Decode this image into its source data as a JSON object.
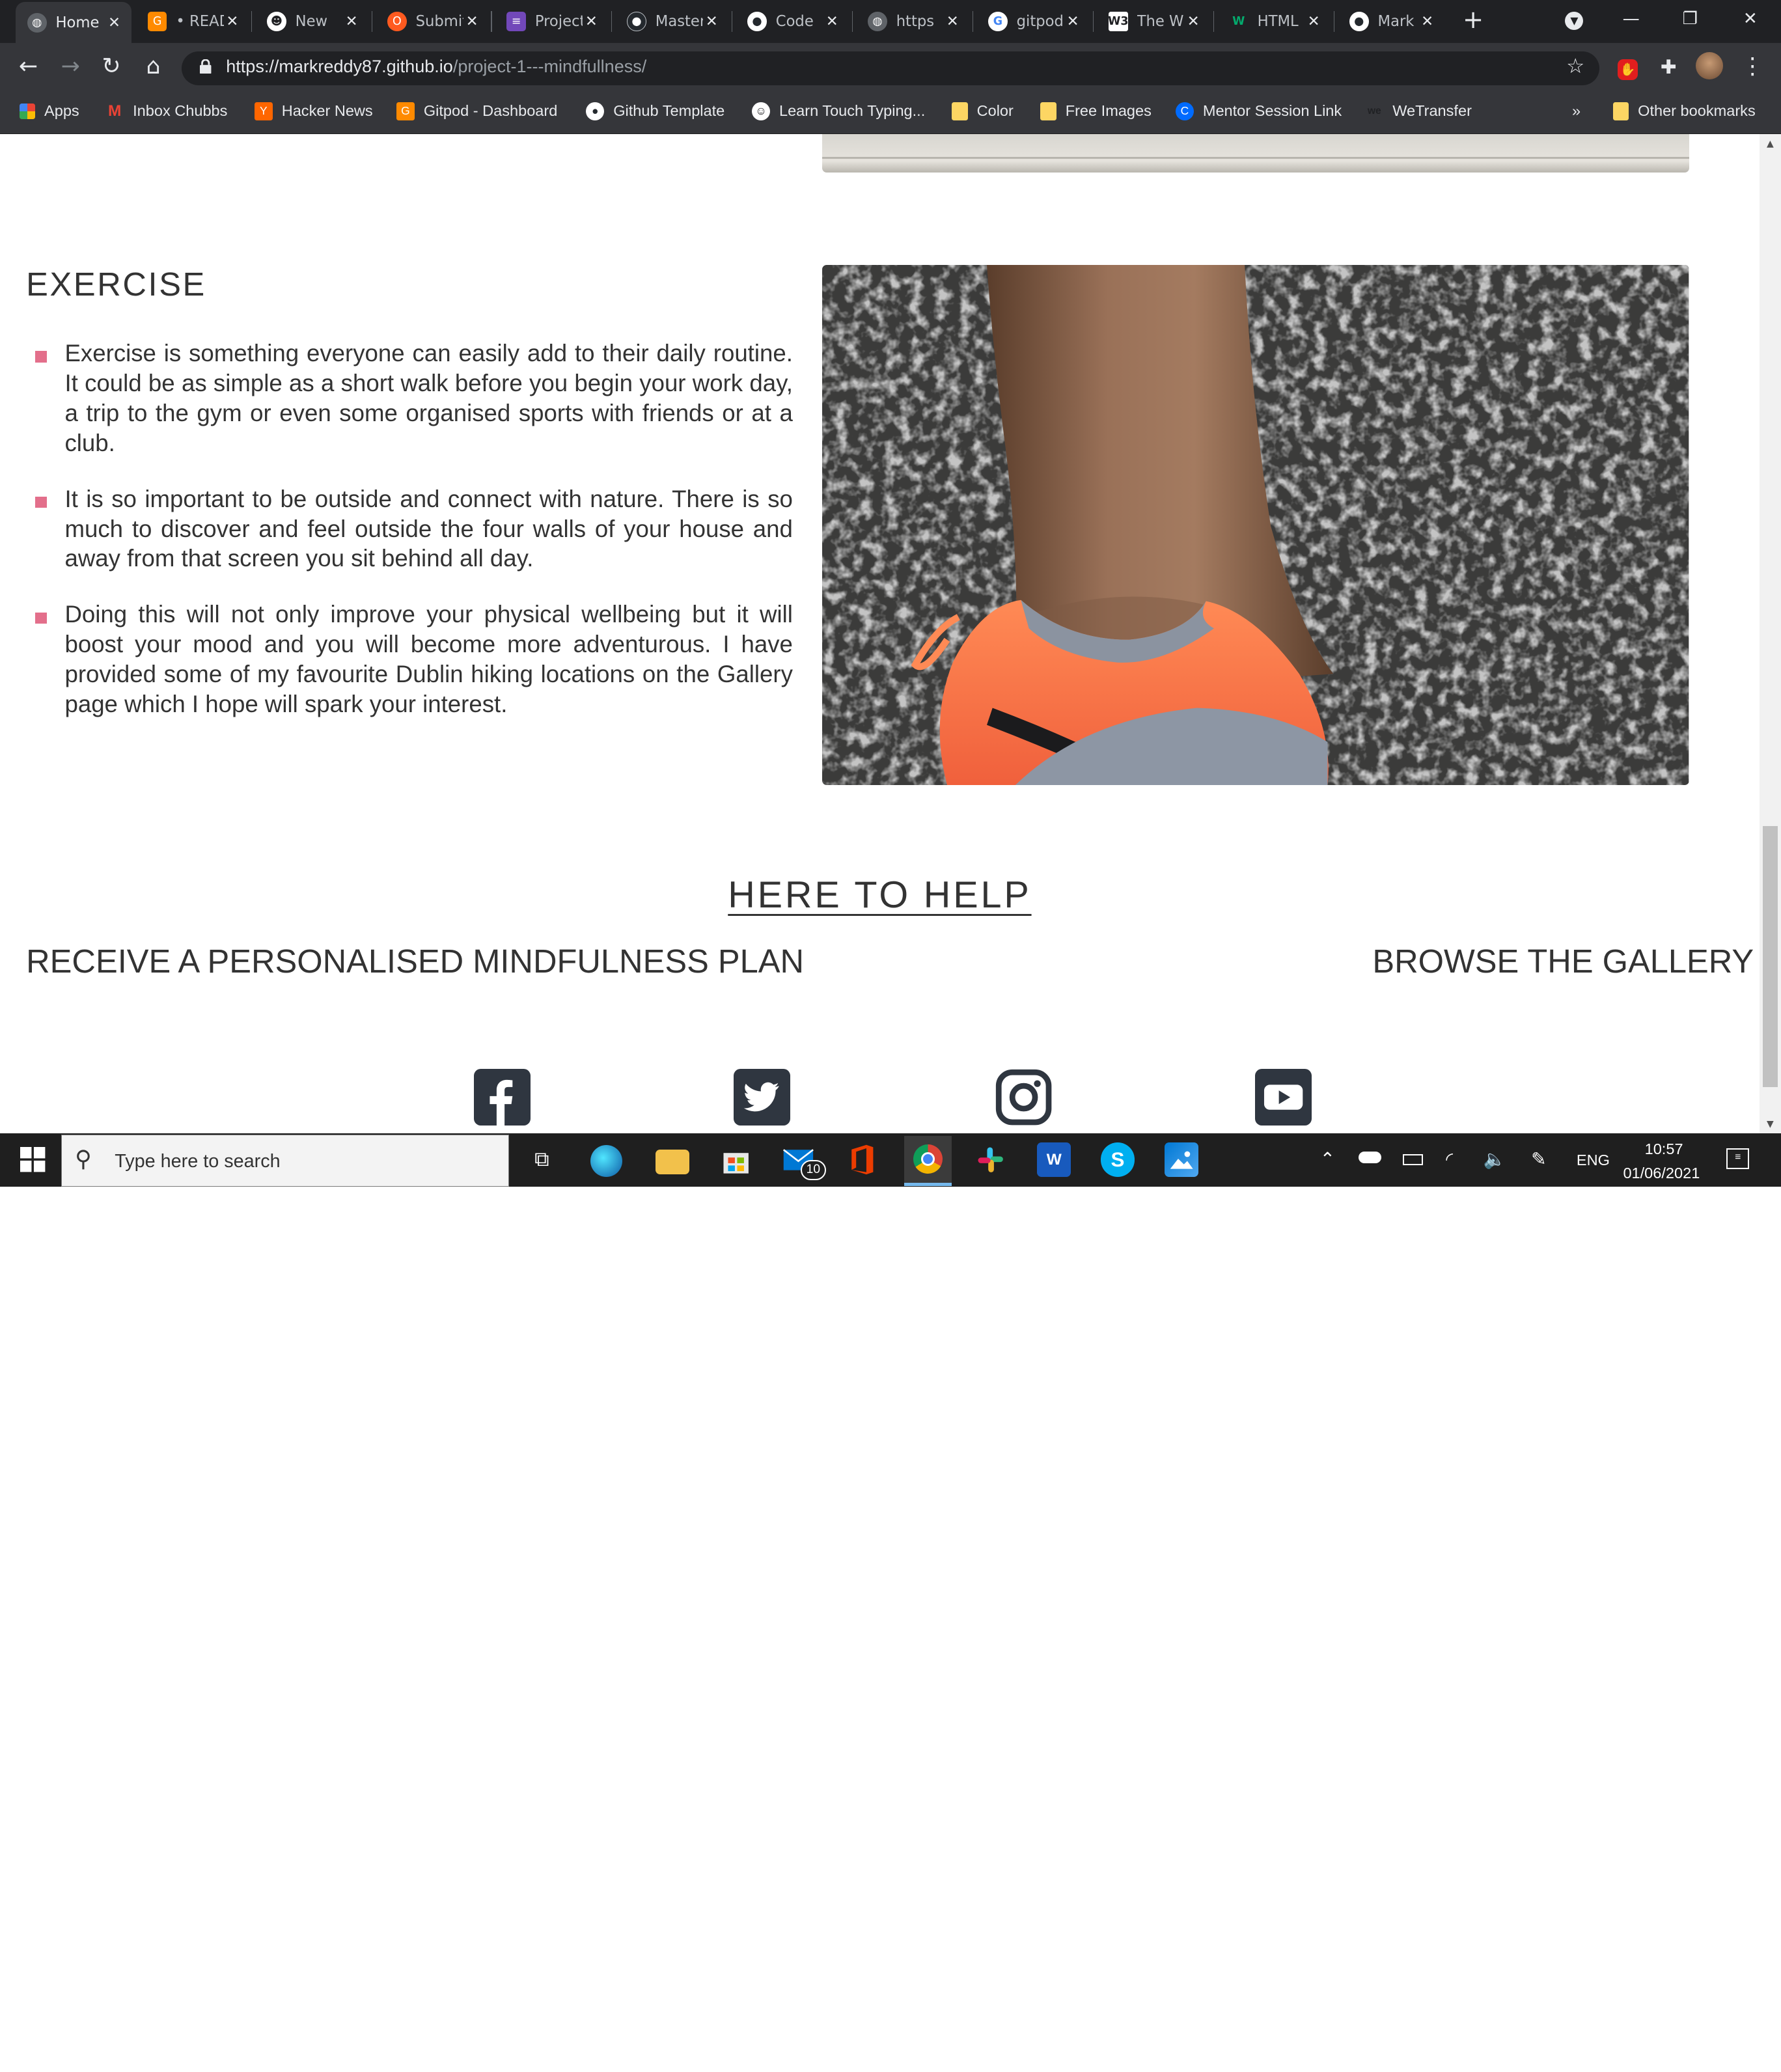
{
  "browser": {
    "tabs": [
      {
        "title": "Home",
        "icon": "globe-icon",
        "active": true
      },
      {
        "title": "• README",
        "icon": "gitpod-icon"
      },
      {
        "title": "New",
        "icon": "smiley-icon"
      },
      {
        "title": "Submit",
        "icon": "opera-icon"
      },
      {
        "title": "Project",
        "icon": "form-icon"
      },
      {
        "title": "Master",
        "icon": "github-icon"
      },
      {
        "title": "Code",
        "icon": "github-icon"
      },
      {
        "title": "https",
        "icon": "globe-icon"
      },
      {
        "title": "gitpod",
        "icon": "google-icon"
      },
      {
        "title": "The W",
        "icon": "w3schools-icon"
      },
      {
        "title": "HTML",
        "icon": "w3-green-icon"
      },
      {
        "title": "Mark",
        "icon": "github-icon"
      }
    ],
    "url_host": "https://markreddy87.github.io",
    "url_path": "/project-1---mindfullness/",
    "bookmarks": [
      {
        "label": "Apps",
        "icon": "apps-grid-icon"
      },
      {
        "label": "Inbox Chubbs",
        "icon": "gmail-icon"
      },
      {
        "label": "Hacker News",
        "icon": "hacker-news-icon"
      },
      {
        "label": "Gitpod - Dashboard",
        "icon": "gitpod-icon"
      },
      {
        "label": "Github Template",
        "icon": "github-icon"
      },
      {
        "label": "Learn Touch Typing...",
        "icon": "typing-icon"
      },
      {
        "label": "Color",
        "icon": "folder-icon"
      },
      {
        "label": "Free Images",
        "icon": "folder-icon"
      },
      {
        "label": "Mentor Session Link",
        "icon": "calendly-icon"
      },
      {
        "label": "WeTransfer",
        "icon": "wetransfer-icon"
      }
    ],
    "bookmarks_overflow": "»",
    "other_bookmarks": "Other bookmarks"
  },
  "page": {
    "exercise_heading": "EXERCISE",
    "exercise_points": [
      "Exercise is something everyone can easily add to their daily routine. It could be as simple as a short walk before you begin your work day, a trip to the gym or even some organised sports with friends or at a club.",
      "It is so important to be outside and connect with nature. There is so much to discover and feel outside the four walls of your house and away from that screen you sit behind all day.",
      "Doing this will not only improve your physical wellbeing but it will boost your mood and you will become more adventurous. I have provided some of my favourite Dublin hiking locations on the Gallery page which I hope will spark your interest."
    ],
    "help_heading": "HERE TO HELP",
    "plan_link": "RECEIVE A PERSONALISED MINDFULNESS PLAN",
    "gallery_link": "BROWSE THE GALLERY",
    "social_icons": [
      "facebook-icon",
      "twitter-icon",
      "instagram-icon",
      "youtube-icon"
    ],
    "bullet_color": "#e36f8b",
    "text_color": "#333333"
  },
  "taskbar": {
    "search_placeholder": "Type here to search",
    "mail_badge": "10",
    "language": "ENG",
    "time": "10:57",
    "date": "01/06/2021"
  }
}
